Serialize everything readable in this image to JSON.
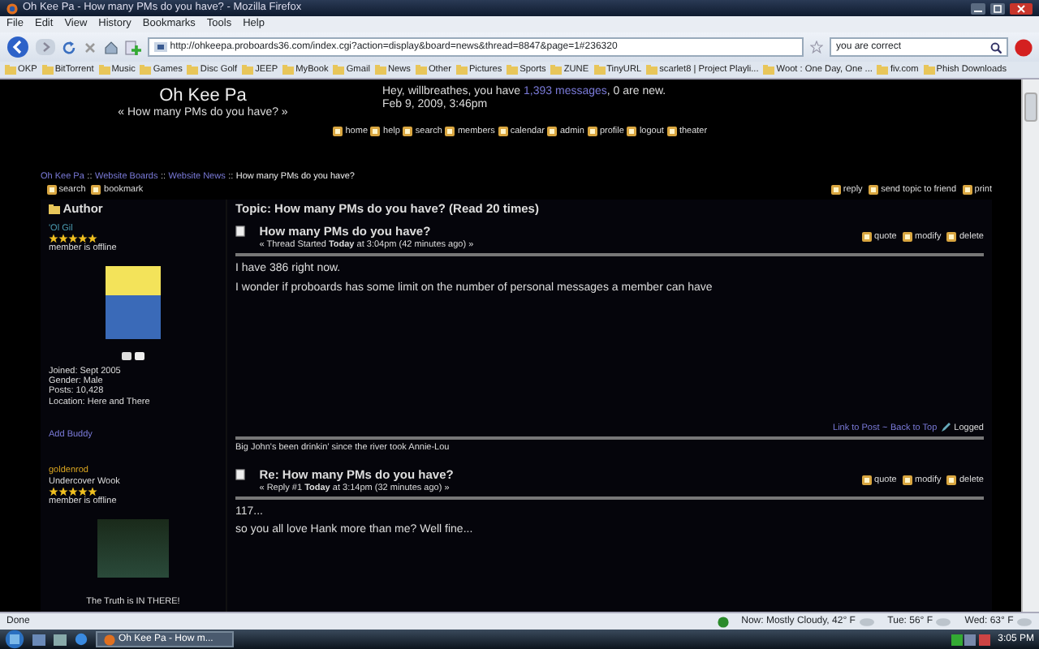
{
  "window": {
    "title": "Oh Kee Pa - How many PMs do you have? - Mozilla Firefox"
  },
  "menu": [
    "File",
    "Edit",
    "View",
    "History",
    "Bookmarks",
    "Tools",
    "Help"
  ],
  "toolbar": {
    "url": "http://ohkeepa.proboards36.com/index.cgi?action=display&board=news&thread=8847&page=1#236320",
    "search_value": "you are correct"
  },
  "bookmarks": [
    "OKP",
    "BitTorrent",
    "Music",
    "Games",
    "Disc Golf",
    "JEEP",
    "MyBook",
    "Gmail",
    "News",
    "Other",
    "Pictures",
    "Sports",
    "ZUNE",
    "TinyURL",
    "scarlet8 | Project Playli...",
    "Woot : One Day, One ...",
    "fiv.com",
    "Phish Downloads"
  ],
  "forum": {
    "site_title": "Oh Kee Pa",
    "subtitle": "« How many PMs do you have? »",
    "greeting": {
      "before": "Hey, willbreathes, you have ",
      "link": "1,393 messages",
      "after": ", 0 are new."
    },
    "date": "Feb 9, 2009, 3:46pm",
    "nav": [
      "home",
      "help",
      "search",
      "members",
      "calendar",
      "admin",
      "profile",
      "logout",
      "theater"
    ],
    "breadcrumb": {
      "separator": "::",
      "items": [
        {
          "label": "Oh Kee Pa",
          "current": false
        },
        {
          "label": "Website Boards",
          "current": false
        },
        {
          "label": "Website News",
          "current": false
        },
        {
          "label": "How many PMs do you have?",
          "current": true
        }
      ]
    },
    "tools_left": [
      "search",
      "bookmark"
    ],
    "tools_right": [
      "reply",
      "send topic to friend",
      "print"
    ],
    "author_header": "Author",
    "topic_header": "Topic: How many PMs do you have? (Read 20 times)",
    "posts": [
      {
        "user": "'Ol Gil",
        "stars": 5,
        "status": "member is offline",
        "details": [
          "Joined: Sept 2005",
          "Gender: Male",
          "Posts: 10,428",
          "Location: Here and There"
        ],
        "add_buddy": "Add Buddy",
        "title": "How many PMs do you have?",
        "meta": "« Thread Started **Today** at 3:04pm (42 minutes ago) »",
        "actions": [
          "quote",
          "modify",
          "delete"
        ],
        "body": [
          "I have 386 right now.",
          "I wonder if proboards has some limit on the number of personal messages a member can have"
        ],
        "footer": {
          "link_to_post": "Link to Post",
          "separator": "~",
          "back_to_top": "Back to Top",
          "logged": "Logged"
        },
        "signature": "Big John's been drinkin' since the river took Annie-Lou"
      },
      {
        "user": "goldenrod",
        "rank": "Undercover Wook",
        "stars": 5,
        "status": "member is offline",
        "caption": "The Truth is IN THERE!",
        "title": "Re: How many PMs do you have?",
        "meta": "« Reply #1 **Today** at 3:14pm (32 minutes ago) »",
        "actions": [
          "quote",
          "modify",
          "delete"
        ],
        "body": [
          "117...",
          "so you all love Hank more than me? Well fine..."
        ]
      }
    ]
  },
  "status_bar": {
    "text": "Done",
    "weather": [
      "Now: Mostly Cloudy, 42° F",
      "Tue: 56° F",
      "Wed: 63° F"
    ]
  },
  "taskbar": {
    "window_button": "Oh Kee Pa - How m...",
    "clock": "3:05 PM"
  }
}
